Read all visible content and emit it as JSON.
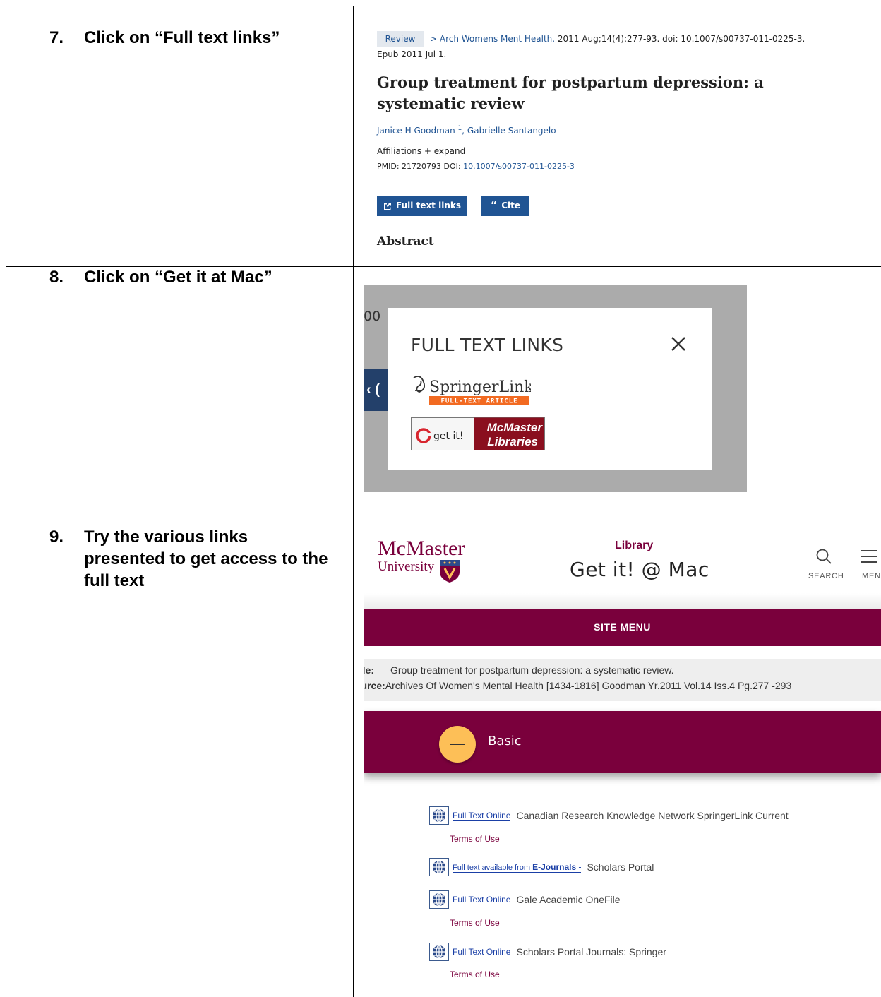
{
  "steps": [
    {
      "number": "7.",
      "text": "Click on “Full text links”"
    },
    {
      "number": "8.",
      "text": "Click on “Get it at Mac”"
    },
    {
      "number": "9.",
      "text": "Try the various links presented to get access to the full text"
    }
  ],
  "pubmed": {
    "badge": "Review",
    "crumb_journal": "> Arch Womens Ment Health.",
    "crumb_rest": " 2011 Aug;14(4):277-93. doi: 10.1007/s00737-011-0225-3.",
    "epub": "Epub 2011 Jul 1.",
    "title": "Group treatment for postpartum depression: a systematic review",
    "author1": "Janice H Goodman",
    "author1_sup": "1",
    "author2": ", Gabrielle Santangelo",
    "affiliations": "Affiliations  + expand",
    "ids_text": "PMID: 21720793   DOI: ",
    "doi_link": "10.1007/s00737-011-0225-3",
    "full_text_button": "Full text links",
    "cite_button": "Cite",
    "abstract_heading": "Abstract"
  },
  "modal": {
    "background_doi": "00",
    "background_button": "‹ (",
    "title": "FULL TEXT LINKS",
    "springer_name": "SpringerLink",
    "springer_tag": "FULL-TEXT ARTICLE",
    "getit_text": "get it!",
    "mcmaster_line1": "McMaster",
    "mcmaster_line2": "Libraries"
  },
  "mcmaster": {
    "logo_line1": "McMaster",
    "logo_line2": "University",
    "library_label": "Library",
    "page_title": "Get it! @ Mac",
    "search_label": "SEARCH",
    "menu_label": "MENU",
    "site_menu": "SITE MENU",
    "title_label": "tle:",
    "title_value": "Group treatment for postpartum depression: a systematic review.",
    "source_label": "ource:",
    "source_value": "Archives Of Women's Mental Health [1434-1816] Goodman Yr.2011 Vol.14 Iss.4 Pg.277 -293",
    "basic_label": "Basic",
    "links": [
      {
        "link_text": "Full Text Online",
        "provider": "Canadian Research Knowledge Network SpringerLink Current",
        "terms": "Terms of Use"
      },
      {
        "link_text": "Full text available from ",
        "link_bold": "E-Journals -",
        "provider": "Scholars Portal",
        "terms": ""
      },
      {
        "link_text": "Full Text Online",
        "provider": "Gale Academic OneFile",
        "terms": "Terms of Use"
      },
      {
        "link_text": "Full Text Online",
        "provider": "Scholars Portal Journals: Springer",
        "terms": "Terms of Use"
      }
    ]
  },
  "colors": {
    "pubmed_blue": "#205493",
    "mcmaster_maroon": "#7a003c",
    "mcmaster_gold": "#fdbf57",
    "springer_orange": "#f26a21"
  }
}
